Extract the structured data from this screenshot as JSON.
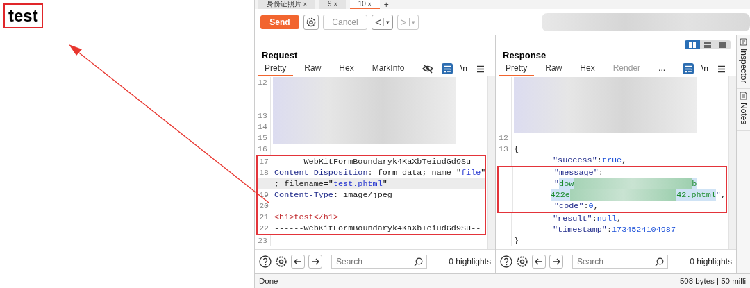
{
  "annotation": {
    "text": "test"
  },
  "tabs": [
    {
      "label": "身份证照片",
      "close": "×",
      "selected": false
    },
    {
      "label": "9",
      "close": "×",
      "selected": false
    },
    {
      "label": "10",
      "close": "×",
      "selected": true
    }
  ],
  "new_tab": "+",
  "toolbar": {
    "send": "Send",
    "cancel": "Cancel",
    "history": [
      {
        "arrow": "<",
        "caret": "▾",
        "disabled": false
      },
      {
        "arrow": ">",
        "caret": "▾",
        "disabled": true
      }
    ]
  },
  "layout_toggle": [
    {
      "kind": "columns",
      "selected": true
    },
    {
      "kind": "rows",
      "selected": false
    },
    {
      "kind": "single",
      "selected": false
    }
  ],
  "panels": [
    {
      "title": "Request",
      "tabs": [
        {
          "label": "Pretty",
          "selected": true,
          "disabled": false
        },
        {
          "label": "Raw",
          "selected": false,
          "disabled": false
        },
        {
          "label": "Hex",
          "selected": false,
          "disabled": false
        },
        {
          "label": "MarkInfo",
          "selected": false,
          "disabled": false
        }
      ],
      "hide_icon": true,
      "wrap_on": true,
      "newline": "\\n",
      "lines": [
        {
          "number": "12",
          "redacted": true,
          "boxed": false,
          "current": false
        },
        {
          "redacted": true,
          "boxed": false,
          "current": false
        },
        {
          "redacted": true,
          "boxed": false,
          "current": false
        },
        {
          "number": "13",
          "redacted": true,
          "boxed": false,
          "current": false
        },
        {
          "number": "14",
          "redacted": true,
          "boxed": false,
          "current": false
        },
        {
          "number": "15",
          "redacted": true,
          "boxed": false,
          "current": false
        },
        {
          "number": "16",
          "redacted": false,
          "boxed": false,
          "current": false
        },
        {
          "number": "17",
          "redacted": false,
          "boxed": true,
          "current": false,
          "tokens": [
            {
              "kind": "plain",
              "text": "------WebKitFormBoundaryk4KaXbTeiudGd9Su"
            }
          ]
        },
        {
          "number": "18",
          "redacted": false,
          "boxed": true,
          "current": false,
          "tokens": [
            {
              "kind": "key",
              "text": "Content-Disposition"
            },
            {
              "kind": "plain",
              "text": ": form-data; name=\""
            },
            {
              "kind": "string",
              "text": "file"
            },
            {
              "kind": "plain",
              "text": "\""
            }
          ]
        },
        {
          "redacted": false,
          "boxed": true,
          "current": true,
          "tokens": [
            {
              "kind": "plain",
              "text": "; filename=\""
            },
            {
              "kind": "string",
              "text": "test.phtml"
            },
            {
              "kind": "plain",
              "text": "\""
            }
          ]
        },
        {
          "number": "19",
          "redacted": false,
          "boxed": true,
          "current": false,
          "tokens": [
            {
              "kind": "key",
              "text": "Content-Type"
            },
            {
              "kind": "plain",
              "text": ": image/jpeg"
            }
          ]
        },
        {
          "number": "20",
          "redacted": false,
          "boxed": true,
          "current": false
        },
        {
          "number": "21",
          "redacted": false,
          "boxed": true,
          "current": false,
          "tokens": [
            {
              "kind": "tag",
              "text": "<h1>test</h1>"
            }
          ]
        },
        {
          "number": "22",
          "redacted": false,
          "boxed": true,
          "current": false,
          "tokens": [
            {
              "kind": "plain",
              "text": "------WebKitFormBoundaryk4KaXbTeiudGd9Su--"
            }
          ]
        },
        {
          "number": "23",
          "redacted": false,
          "boxed": false,
          "current": false
        }
      ],
      "search": {
        "placeholder": "Search"
      },
      "highlights": "0 highlights"
    },
    {
      "title": "Response",
      "tabs": [
        {
          "label": "Pretty",
          "selected": true,
          "disabled": false
        },
        {
          "label": "Raw",
          "selected": false,
          "disabled": false
        },
        {
          "label": "Hex",
          "selected": false,
          "disabled": false
        },
        {
          "label": "Render",
          "selected": false,
          "disabled": true
        },
        {
          "label": "...",
          "selected": false,
          "disabled": false
        }
      ],
      "wrap_on": true,
      "newline": "\\n",
      "lines": [
        {
          "redacted": true,
          "boxed": false,
          "current": false
        },
        {
          "redacted": true,
          "boxed": false,
          "current": false
        },
        {
          "redacted": true,
          "boxed": false,
          "current": false
        },
        {
          "redacted": true,
          "boxed": false,
          "current": false
        },
        {
          "redacted": true,
          "boxed": false,
          "current": false
        },
        {
          "number": "12",
          "redacted": false,
          "boxed": false,
          "current": false
        },
        {
          "number": "13",
          "redacted": false,
          "boxed": false,
          "current": false,
          "tokens": [
            {
              "kind": "plain",
              "text": "{"
            }
          ]
        },
        {
          "redacted": false,
          "boxed": false,
          "current": false,
          "tokens": [
            {
              "kind": "indent"
            },
            {
              "kind": "key",
              "text": "\"success\""
            },
            {
              "kind": "plain",
              "text": ":"
            },
            {
              "kind": "value",
              "text": "true"
            },
            {
              "kind": "plain",
              "text": ","
            }
          ]
        },
        {
          "redacted": false,
          "boxed": true,
          "current": false,
          "tokens": [
            {
              "kind": "indent"
            },
            {
              "kind": "key",
              "text": "\"message\""
            },
            {
              "kind": "plain",
              "text": ":"
            }
          ]
        },
        {
          "redacted": false,
          "boxed": true,
          "current": false,
          "tokens": [
            {
              "kind": "indent"
            },
            {
              "kind": "key",
              "text": "\""
            },
            {
              "kind": "string_selected",
              "text": "dow"
            },
            {
              "kind": "redacted"
            },
            {
              "kind": "string_selected",
              "text": "b"
            }
          ]
        },
        {
          "redacted": false,
          "boxed": true,
          "current": false,
          "tokens": [
            {
              "kind": "indent"
            },
            {
              "kind": "string_selected",
              "text": "422e"
            },
            {
              "kind": "redacted"
            },
            {
              "kind": "string_selected",
              "text": "42.phtml"
            },
            {
              "kind": "key",
              "text": "\""
            },
            {
              "kind": "plain",
              "text": ","
            }
          ]
        },
        {
          "redacted": false,
          "boxed": true,
          "current": false,
          "tokens": [
            {
              "kind": "indent"
            },
            {
              "kind": "key",
              "text": "\"code\""
            },
            {
              "kind": "plain",
              "text": ":"
            },
            {
              "kind": "value",
              "text": "0"
            },
            {
              "kind": "plain",
              "text": ","
            }
          ]
        },
        {
          "redacted": false,
          "boxed": false,
          "current": false,
          "tokens": [
            {
              "kind": "indent"
            },
            {
              "kind": "key",
              "text": "\"result\""
            },
            {
              "kind": "plain",
              "text": ":"
            },
            {
              "kind": "value",
              "text": "null"
            },
            {
              "kind": "plain",
              "text": ","
            }
          ]
        },
        {
          "redacted": false,
          "boxed": false,
          "current": false,
          "tokens": [
            {
              "kind": "indent"
            },
            {
              "kind": "key",
              "text": "\"timestamp\""
            },
            {
              "kind": "plain",
              "text": ":"
            },
            {
              "kind": "value",
              "text": "1734524104987"
            }
          ]
        },
        {
          "redacted": false,
          "boxed": false,
          "current": false,
          "tokens": [
            {
              "kind": "plain",
              "text": "}"
            }
          ]
        }
      ],
      "search": {
        "placeholder": "Search"
      },
      "highlights": "0 highlights"
    }
  ],
  "side_tabs": [
    "Inspector",
    "Notes"
  ],
  "status": {
    "left": "Done",
    "right": "508 bytes | 50 milli"
  }
}
